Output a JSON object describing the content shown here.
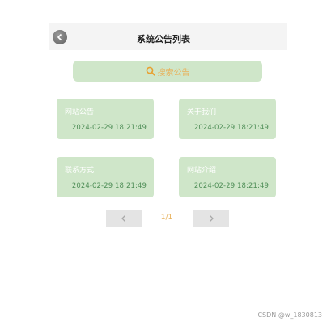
{
  "header": {
    "title": "系统公告列表"
  },
  "search": {
    "label": "搜索公告"
  },
  "announcements": [
    {
      "title": "网站公告",
      "date": "2024-02-29 18:21:49"
    },
    {
      "title": "关于我们",
      "date": "2024-02-29 18:21:49"
    },
    {
      "title": "联系方式",
      "date": "2024-02-29 18:21:49"
    },
    {
      "title": "网站介绍",
      "date": "2024-02-29 18:21:49"
    }
  ],
  "pagination": {
    "indicator": "1/1"
  },
  "watermark": "CSDN @w_1830813",
  "colors": {
    "card": "#cfe6c9",
    "accent": "#e8b15a",
    "date": "#4f8e57",
    "header": "#f4f4f4",
    "pager": "#e4e4e4"
  }
}
